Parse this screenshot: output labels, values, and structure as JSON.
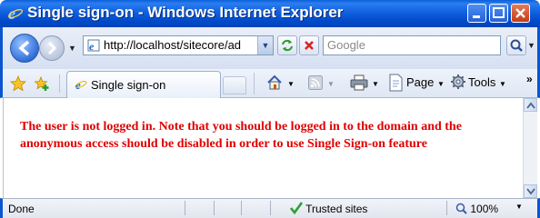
{
  "window": {
    "title": "Single sign-on - Windows Internet Explorer"
  },
  "address_bar": {
    "url": "http://localhost/sitecore/ad",
    "search_placeholder": "Google"
  },
  "tabs": [
    {
      "label": "Single sign-on"
    }
  ],
  "command_bar": {
    "page_label": "Page",
    "tools_label": "Tools",
    "more": "»"
  },
  "content": {
    "message": "The user is not logged in. Note that you should be logged in to the domain and the anonymous access should be disabled in order to use Single Sign-on feature",
    "message_color": "#e00000"
  },
  "status_bar": {
    "status": "Done",
    "zone": "Trusted sites",
    "zoom": "100%"
  },
  "colors": {
    "titlebar": "#0a5fd8",
    "window_border": "#0a55d0"
  }
}
